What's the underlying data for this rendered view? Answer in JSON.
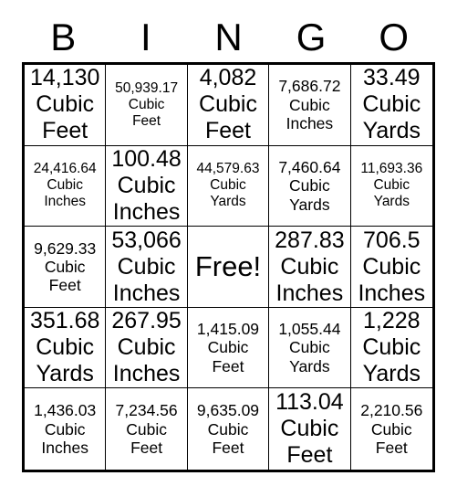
{
  "header": {
    "letters": [
      "B",
      "I",
      "N",
      "G",
      "O"
    ]
  },
  "grid": {
    "rows": [
      [
        {
          "value": "14,130",
          "unit_line1": "Cubic",
          "unit_line2": "Feet"
        },
        {
          "value": "50,939.17",
          "unit_line1": "Cubic",
          "unit_line2": "Feet"
        },
        {
          "value": "4,082",
          "unit_line1": "Cubic",
          "unit_line2": "Feet"
        },
        {
          "value": "7,686.72",
          "unit_line1": "Cubic",
          "unit_line2": "Inches"
        },
        {
          "value": "33.49",
          "unit_line1": "Cubic",
          "unit_line2": "Yards"
        }
      ],
      [
        {
          "value": "24,416.64",
          "unit_line1": "Cubic",
          "unit_line2": "Inches"
        },
        {
          "value": "100.48",
          "unit_line1": "Cubic",
          "unit_line2": "Inches"
        },
        {
          "value": "44,579.63",
          "unit_line1": "Cubic",
          "unit_line2": "Yards"
        },
        {
          "value": "7,460.64",
          "unit_line1": "Cubic",
          "unit_line2": "Yards"
        },
        {
          "value": "11,693.36",
          "unit_line1": "Cubic",
          "unit_line2": "Yards"
        }
      ],
      [
        {
          "value": "9,629.33",
          "unit_line1": "Cubic",
          "unit_line2": "Feet"
        },
        {
          "value": "53,066",
          "unit_line1": "Cubic",
          "unit_line2": "Inches"
        },
        {
          "value": "Free!",
          "unit_line1": "",
          "unit_line2": ""
        },
        {
          "value": "287.83",
          "unit_line1": "Cubic",
          "unit_line2": "Inches"
        },
        {
          "value": "706.5",
          "unit_line1": "Cubic",
          "unit_line2": "Inches"
        }
      ],
      [
        {
          "value": "351.68",
          "unit_line1": "Cubic",
          "unit_line2": "Yards"
        },
        {
          "value": "267.95",
          "unit_line1": "Cubic",
          "unit_line2": "Inches"
        },
        {
          "value": "1,415.09",
          "unit_line1": "Cubic",
          "unit_line2": "Feet"
        },
        {
          "value": "1,055.44",
          "unit_line1": "Cubic",
          "unit_line2": "Yards"
        },
        {
          "value": "1,228",
          "unit_line1": "Cubic",
          "unit_line2": "Yards"
        }
      ],
      [
        {
          "value": "1,436.03",
          "unit_line1": "Cubic",
          "unit_line2": "Inches"
        },
        {
          "value": "7,234.56",
          "unit_line1": "Cubic",
          "unit_line2": "Feet"
        },
        {
          "value": "9,635.09",
          "unit_line1": "Cubic",
          "unit_line2": "Feet"
        },
        {
          "value": "113.04",
          "unit_line1": "Cubic",
          "unit_line2": "Feet"
        },
        {
          "value": "2,210.56",
          "unit_line1": "Cubic",
          "unit_line2": "Feet"
        }
      ]
    ]
  },
  "colors": {
    "background": "#ffffff",
    "text": "#000000",
    "border": "#000000"
  }
}
